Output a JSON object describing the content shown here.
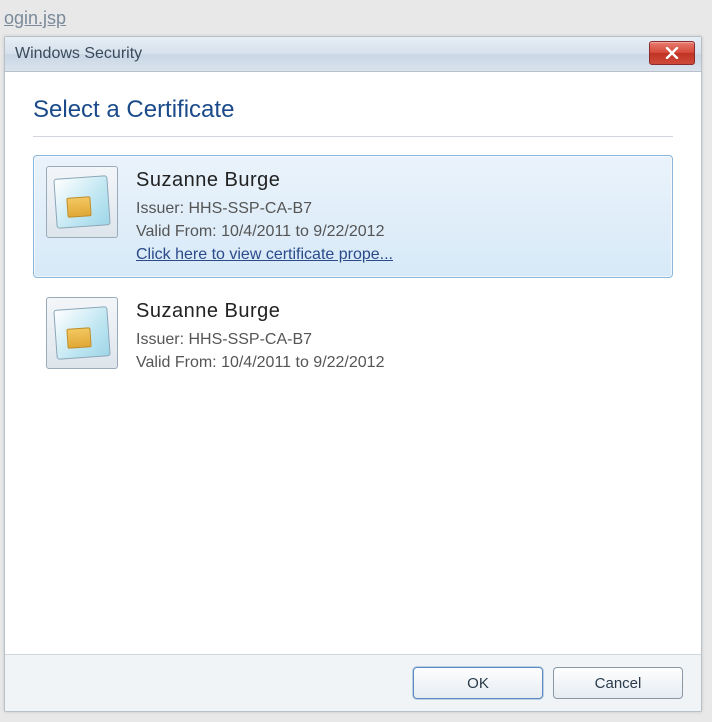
{
  "page": {
    "crumb": "ogin.jsp"
  },
  "dialog": {
    "title": "Windows Security",
    "heading": "Select a Certificate",
    "certificates": [
      {
        "name": "Suzanne Burge",
        "issuer_label": "Issuer:",
        "issuer": "HHS-SSP-CA-B7",
        "valid_label": "Valid From:",
        "valid_range": "10/4/2011 to 9/22/2012",
        "details_link": "Click here to view certificate prope...",
        "selected": true
      },
      {
        "name": "Suzanne Burge",
        "issuer_label": "Issuer:",
        "issuer": "HHS-SSP-CA-B7",
        "valid_label": "Valid From:",
        "valid_range": "10/4/2011 to 9/22/2012",
        "selected": false
      }
    ],
    "buttons": {
      "ok": "OK",
      "cancel": "Cancel"
    }
  }
}
